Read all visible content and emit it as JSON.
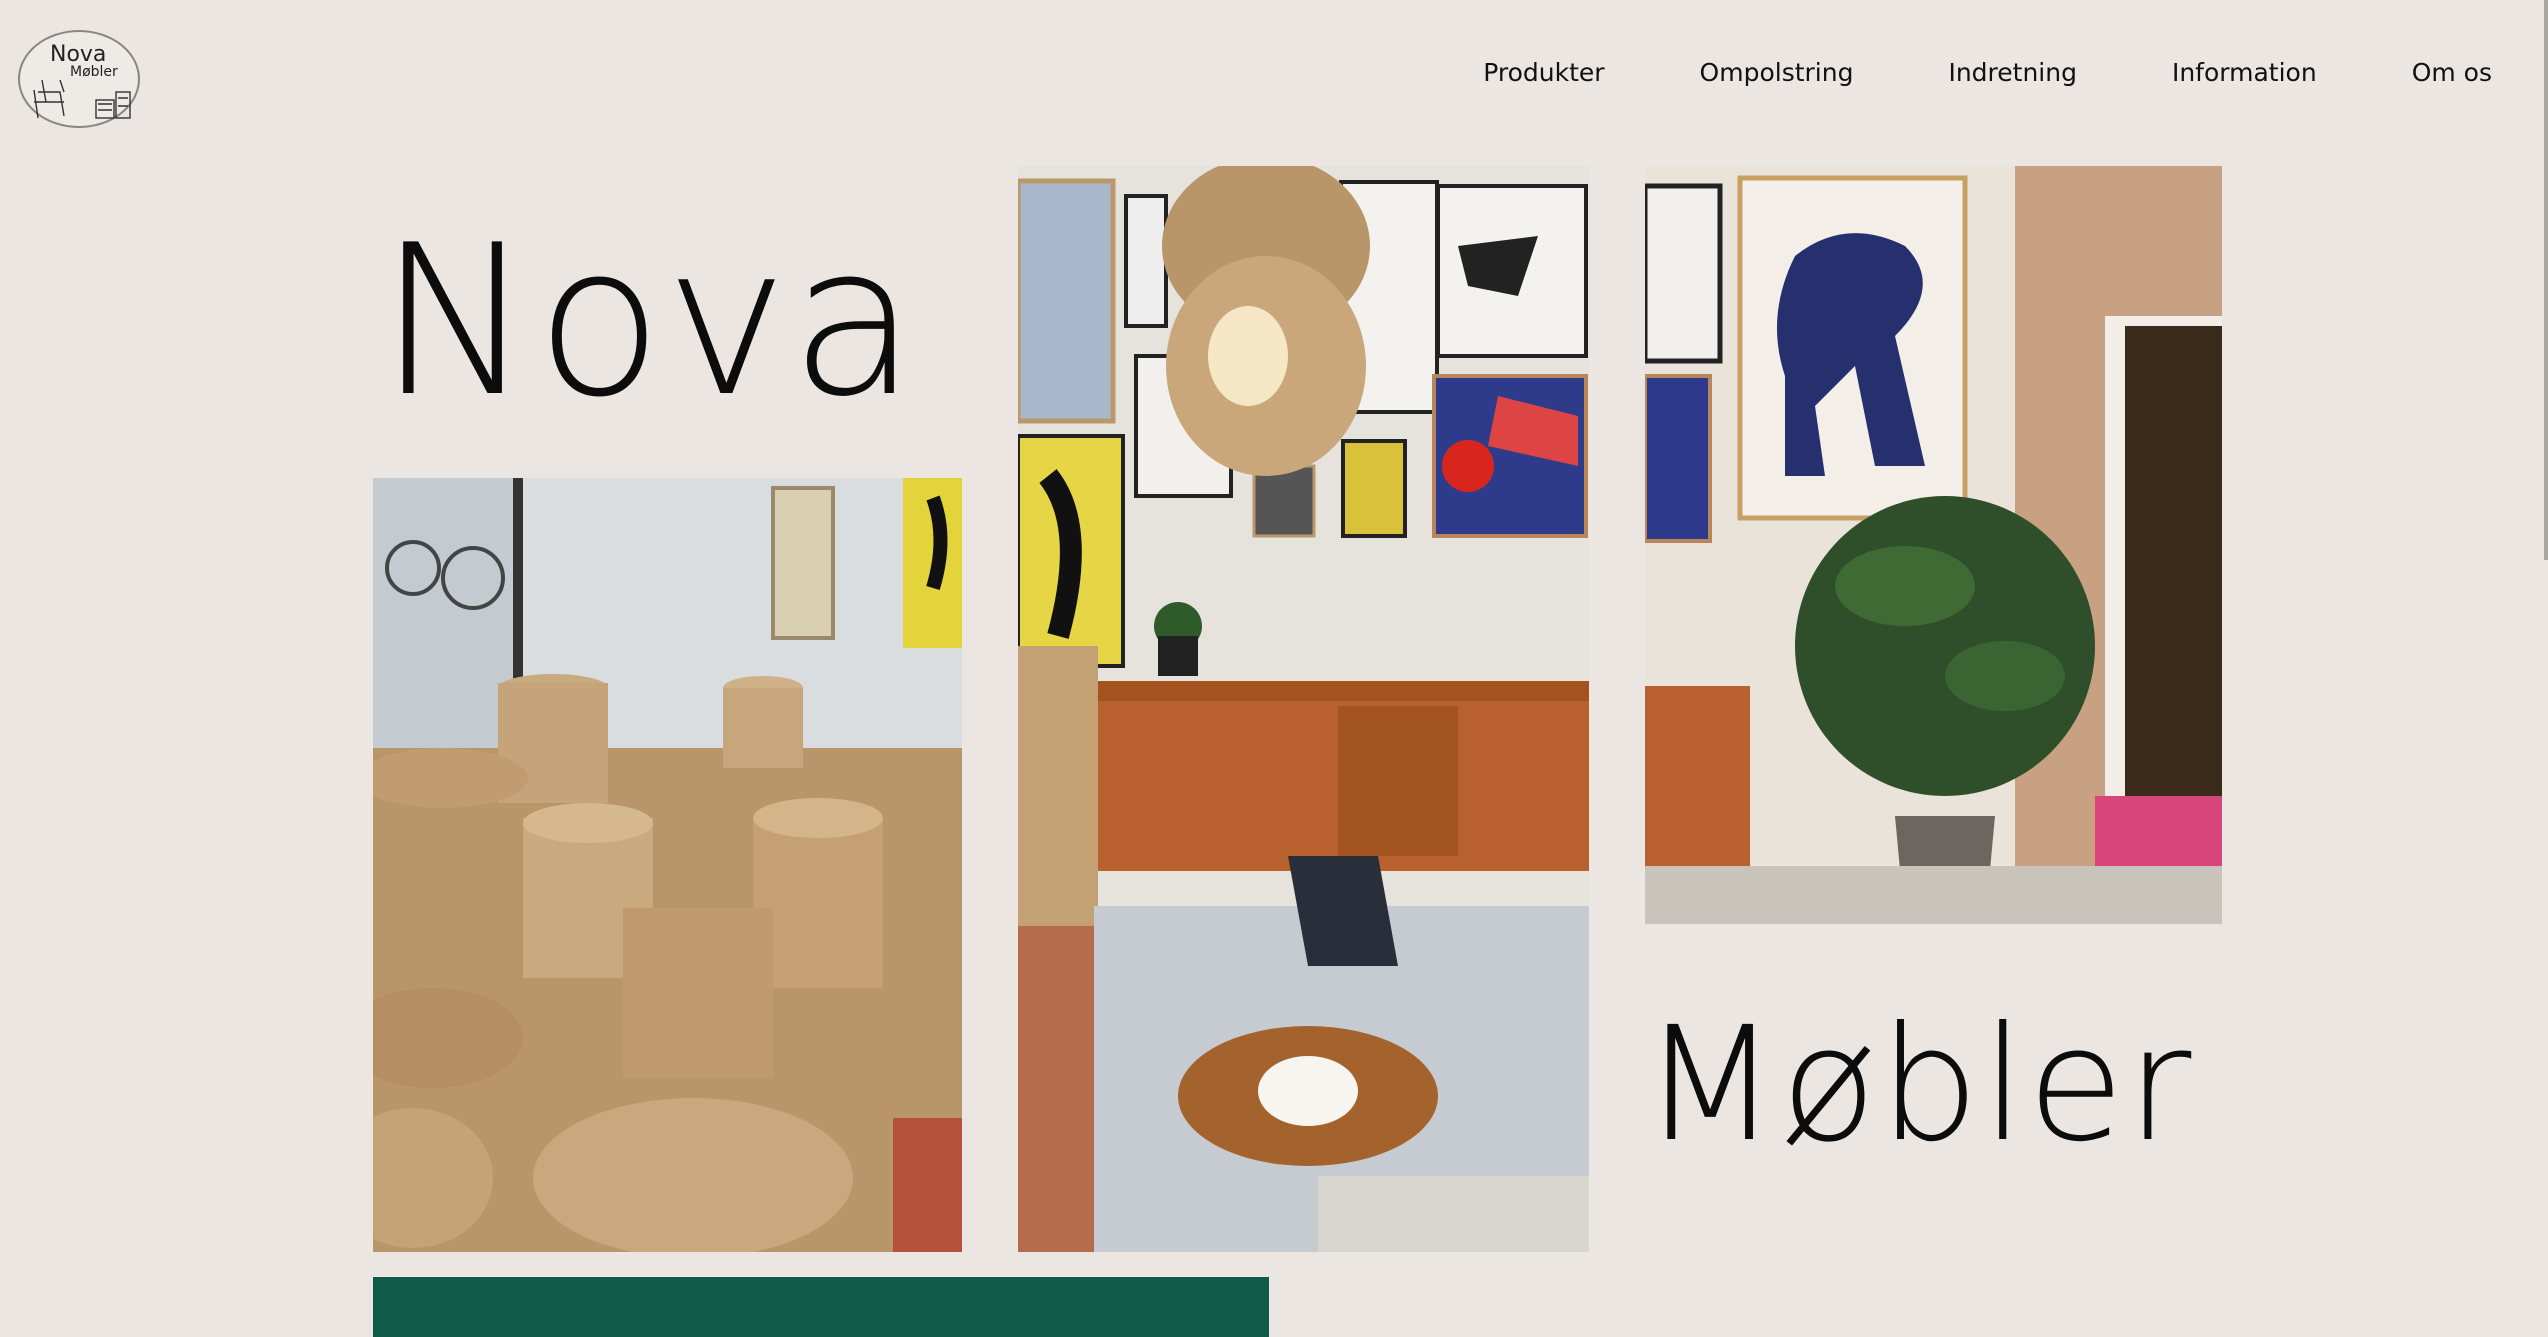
{
  "logo": {
    "line1": "Nova",
    "line2": "Møbler"
  },
  "nav": {
    "items": [
      "Produkter",
      "Ompolstring",
      "Indretning",
      "Information",
      "Om os"
    ]
  },
  "hero": {
    "word1": "Nova",
    "word2": "Møbler"
  },
  "colors": {
    "background": "#ebe6e1",
    "accent_green": "#0f5a49"
  },
  "images": [
    "baskets-photo",
    "living-room-photo",
    "plant-room-photo"
  ]
}
